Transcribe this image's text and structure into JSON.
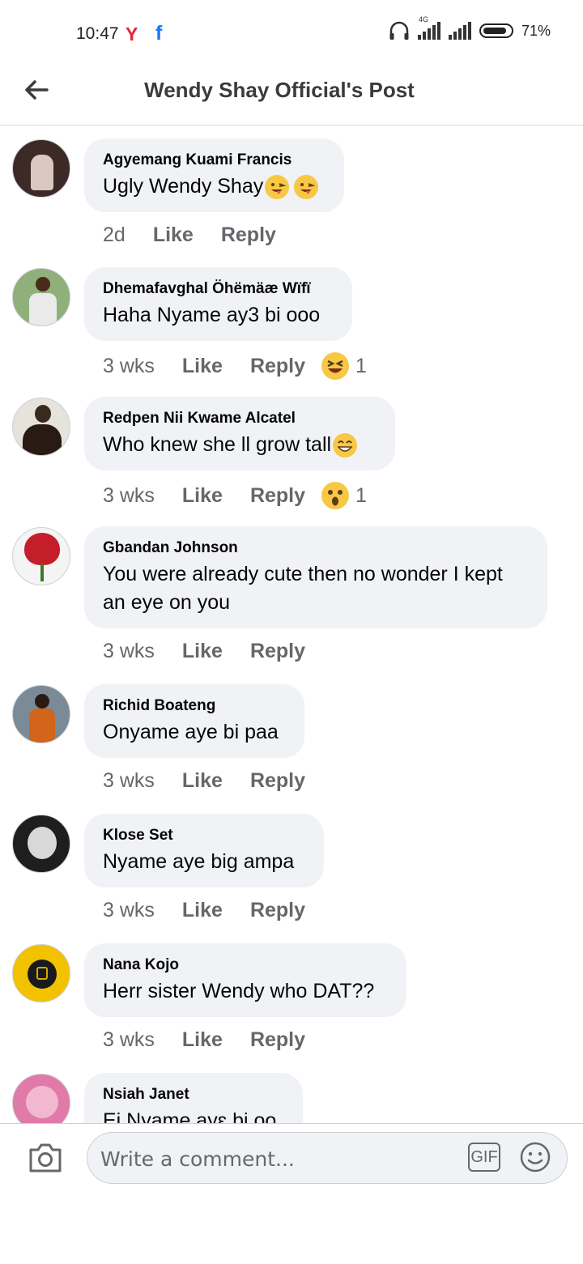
{
  "status_bar": {
    "time": "10:47",
    "app_icon_1": "Y",
    "app_icon_2": "f",
    "network_label": "4G",
    "battery": "71%"
  },
  "header": {
    "title": "Wendy Shay Official's Post",
    "back_icon": "arrow-left-icon"
  },
  "comments": [
    {
      "author": "Agyemang Kuami Francis",
      "text": "Ugly Wendy Shay",
      "emojis": [
        "winking-tongue-emoji",
        "winking-tongue-emoji"
      ],
      "time": "2d",
      "like": "Like",
      "reply": "Reply",
      "reaction": null,
      "reaction_count": null,
      "avatar_color": "#3b2a26"
    },
    {
      "author": "Dhemafavghal Öhëmäæ Wïfï",
      "text": "Haha Nyame ay3 bi ooo",
      "emojis": [],
      "time": "3 wks",
      "like": "Like",
      "reply": "Reply",
      "reaction": "haha-emoji",
      "reaction_count": "1",
      "avatar_color": "#8fb07a"
    },
    {
      "author": "Redpen Nii Kwame Alcatel",
      "text": "Who knew she ll grow tall",
      "emojis": [
        "grinning-emoji"
      ],
      "time": "3 wks",
      "like": "Like",
      "reply": "Reply",
      "reaction": "wow-emoji",
      "reaction_count": "1",
      "avatar_color": "#5a4a3a"
    },
    {
      "author": "Gbandan Johnson",
      "text": "You were already cute then no wonder I kept an eye on you",
      "emojis": [],
      "time": "3 wks",
      "like": "Like",
      "reply": "Reply",
      "reaction": null,
      "reaction_count": null,
      "avatar_color": "#c41e2a"
    },
    {
      "author": "Richid Boateng",
      "text": "Onyame aye bi paa",
      "emojis": [],
      "time": "3 wks",
      "like": "Like",
      "reply": "Reply",
      "reaction": null,
      "reaction_count": null,
      "avatar_color": "#c9661f"
    },
    {
      "author": "Klose Set",
      "text": "Nyame aye big ampa",
      "emojis": [],
      "time": "3 wks",
      "like": "Like",
      "reply": "Reply",
      "reaction": null,
      "reaction_count": null,
      "avatar_color": "#2a2a2a"
    },
    {
      "author": "Nana Kojo",
      "text": "Herr sister Wendy who DAT??",
      "emojis": [],
      "time": "3 wks",
      "like": "Like",
      "reply": "Reply",
      "reaction": null,
      "reaction_count": null,
      "avatar_color": "#f2c200"
    },
    {
      "author": "Nsiah Janet",
      "text": "Ei Nyame ayɛ bi oo",
      "emojis": [],
      "time": "",
      "like": "",
      "reply": "",
      "reaction": null,
      "reaction_count": null,
      "avatar_color": "#e07aa8"
    }
  ],
  "composer": {
    "placeholder": "Write a comment...",
    "camera_icon": "camera-icon",
    "gif_label": "GIF",
    "emoji_icon": "smiley-icon"
  }
}
